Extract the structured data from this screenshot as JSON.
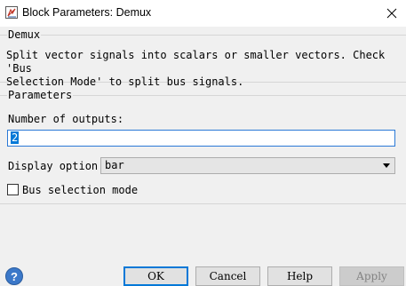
{
  "window": {
    "title": "Block Parameters: Demux",
    "close_icon": "close-icon"
  },
  "block": {
    "group_label": "Demux",
    "description": "Split vector signals into scalars or smaller vectors. Check 'Bus\nSelection Mode' to split bus signals."
  },
  "parameters": {
    "group_label": "Parameters",
    "outputs_label": "Number of outputs:",
    "outputs_value": "2",
    "display_label": "Display option:",
    "display_value": "bar",
    "bus_mode_label": "Bus selection mode",
    "bus_mode_checked": false
  },
  "footer": {
    "help_icon": "help-icon",
    "ok_label": "OK",
    "cancel_label": "Cancel",
    "help_label": "Help",
    "apply_label": "Apply"
  },
  "colors": {
    "focus": "#0078d7",
    "help_icon": "#3b78c9"
  }
}
